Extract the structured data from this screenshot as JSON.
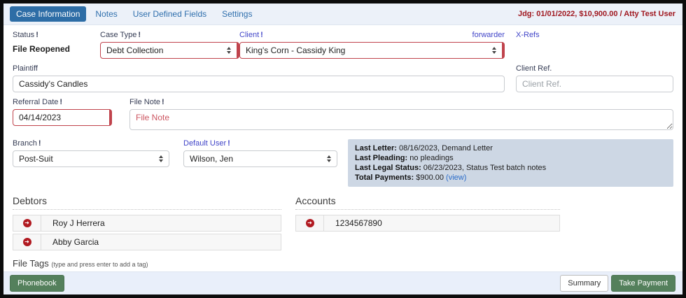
{
  "header": {
    "tabs": [
      {
        "label": "Case Information",
        "active": true
      },
      {
        "label": "Notes",
        "active": false
      },
      {
        "label": "User Defined Fields",
        "active": false
      },
      {
        "label": "Settings",
        "active": false
      }
    ],
    "judgment_info": "Jdg: 01/01/2022, $10,900.00 / Atty Test User"
  },
  "form": {
    "status": {
      "label": "Status",
      "marker": "!",
      "value": "File Reopened"
    },
    "case_type": {
      "label": "Case Type",
      "marker": "!",
      "value": "Debt Collection"
    },
    "client": {
      "label": "Client",
      "marker": "!",
      "value": "King's Corn - Cassidy King"
    },
    "forwarder_link": "forwarder",
    "xrefs_link": "X-Refs",
    "plaintiff": {
      "label": "Plaintiff",
      "value": "Cassidy's Candles"
    },
    "client_ref": {
      "label": "Client Ref.",
      "placeholder": "Client Ref."
    },
    "referral_date": {
      "label": "Referral Date",
      "marker": "!",
      "value": "04/14/2023"
    },
    "file_note": {
      "label": "File Note",
      "marker": "!",
      "placeholder": "File Note"
    },
    "branch": {
      "label": "Branch",
      "marker": "!",
      "value": "Post-Suit"
    },
    "default_user": {
      "label": "Default User",
      "marker": "!",
      "value": "Wilson, Jen"
    }
  },
  "summary_box": {
    "lines": [
      {
        "label": "Last Letter:",
        "text": " 08/16/2023, Demand Letter"
      },
      {
        "label": "Last Pleading:",
        "text": " no pleadings"
      },
      {
        "label": "Last Legal Status:",
        "text": " 06/23/2023, Status Test batch notes"
      },
      {
        "label": "Total Payments:",
        "text": " $900.00 ",
        "link": "(view)"
      }
    ]
  },
  "debtors": {
    "title": "Debtors",
    "rows": [
      "Roy J Herrera",
      "Abby Garcia"
    ]
  },
  "accounts": {
    "title": "Accounts",
    "rows": [
      "1234567890"
    ]
  },
  "file_tags": {
    "title": "File Tags",
    "hint": "(type and press enter to add a tag)"
  },
  "footer": {
    "phonebook": "Phonebook",
    "summary": "Summary",
    "take_payment": "Take Payment"
  },
  "icons": {
    "row_action": "red-circle-arrow-icon",
    "select_caret": "up-down-caret-icon"
  },
  "colors": {
    "active_tab": "#2d6da6",
    "tab_link": "#2f6fad",
    "judgment_text": "#a01820",
    "label_link": "#4145c8",
    "validation_red": "#c0434c",
    "info_box_bg": "#cdd7e4",
    "button_green": "#54805c",
    "row_icon_red": "#b11a21"
  }
}
